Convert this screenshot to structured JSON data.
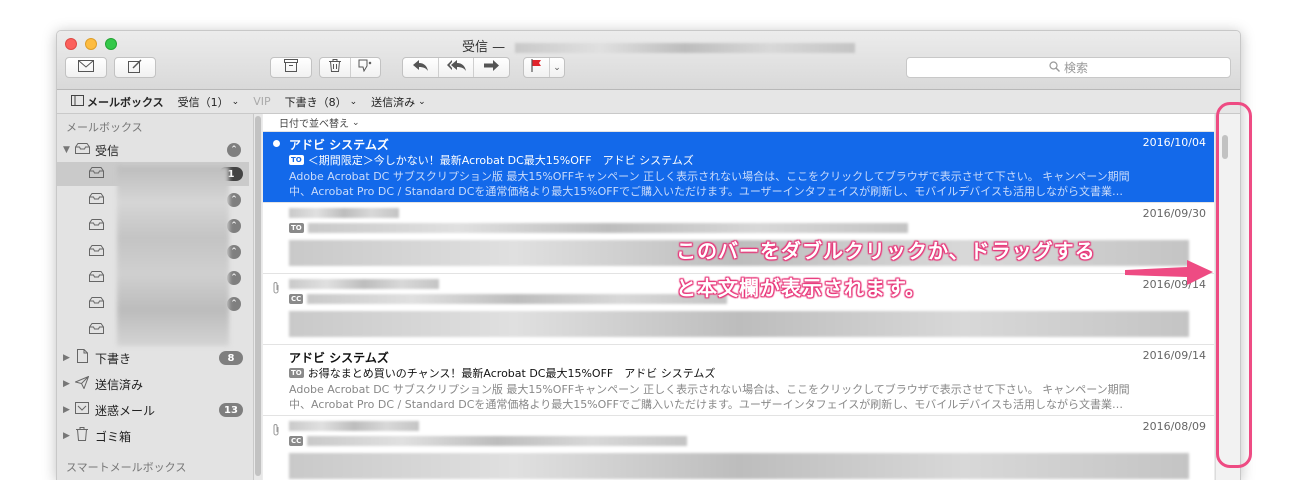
{
  "window": {
    "title": "受信 —"
  },
  "toolbar": {
    "search_placeholder": "検索",
    "flag_color": "#e0242b",
    "buttons": [
      "envelope-icon",
      "compose-icon",
      "archive-icon",
      "trash-icon",
      "junk-icon",
      "reply-icon",
      "reply-all-icon",
      "forward-icon",
      "flag-icon"
    ]
  },
  "favorites": {
    "mailboxes": "メールボックス",
    "inbox": "受信（1）",
    "vip": "VIP",
    "drafts": "下書き（8）",
    "sent": "送信済み"
  },
  "sidebar": {
    "header_mailboxes": "メールボックス",
    "inbox": {
      "label": "受信",
      "badge": "1"
    },
    "drafts": {
      "label": "下書き",
      "badge": "8"
    },
    "sent": {
      "label": "送信済み"
    },
    "junk": {
      "label": "迷惑メール",
      "badge": "13"
    },
    "trash": {
      "label": "ゴミ箱"
    },
    "header_smart": "スマートメールボックス"
  },
  "list": {
    "sort_label": "日付で並べ替え",
    "messages": [
      {
        "sender": "アドビ システムズ",
        "date": "2016/10/04",
        "tag": "TO",
        "subject": "＜期間限定＞今しかない！最新Acrobat DC最大15%OFF　アドビ システムズ",
        "preview1": "Adobe Acrobat DC サブスクリプション版 最大15%OFFキャンペーン 正しく表示されない場合は、ここをクリックしてブラウザで表示させて下さい。 キャンペーン期間",
        "preview2": "中、Acrobat Pro DC / Standard DCを通常価格より最大15%OFFでご購入いただけます。ユーザーインタフェイスが刷新し、モバイルデバイスも活用しながら文書業…"
      },
      {
        "date": "2016/09/30",
        "tag": "TO"
      },
      {
        "date": "2016/09/14",
        "tag": "CC"
      },
      {
        "sender": "アドビ システムズ",
        "date": "2016/09/14",
        "tag": "TO",
        "subject": "お得なまとめ買いのチャンス！最新Acrobat DC最大15%OFF　アドビ システムズ",
        "preview1": "Adobe Acrobat DC サブスクリプション版 最大15%OFFキャンペーン 正しく表示されない場合は、ここをクリックしてブラウザで表示させて下さい。 キャンペーン期間",
        "preview2": "中、Acrobat Pro DC / Standard DCを通常価格より最大15%OFFでご購入いただけます。ユーザーインタフェイスが刷新し、モバイルデバイスも活用しながら文書業…"
      },
      {
        "date": "2016/08/09",
        "tag": "CC"
      }
    ]
  },
  "annotation": {
    "line1": "このバーをダブルクリックか、ドラッグする",
    "line2": "と本文欄が表示されます。",
    "color": "#ee4b83"
  }
}
